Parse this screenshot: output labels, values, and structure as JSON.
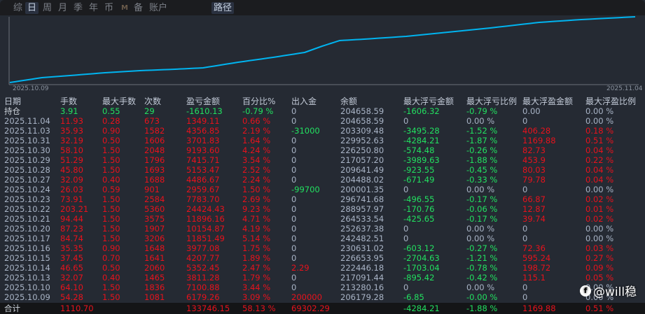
{
  "tabs": [
    "综",
    "日",
    "周",
    "月",
    "季",
    "年",
    "币",
    "M",
    "备",
    "账户",
    "路径"
  ],
  "active_tabs": [
    "日",
    "路径"
  ],
  "chart": {
    "x_start_label": "2025.10.09",
    "x_end_label": "2025.11.04",
    "line_color": "#00b4f0"
  },
  "columns": [
    "日期",
    "手数",
    "最大手数",
    "次数",
    "盈亏金额",
    "百分比%",
    "出入金",
    "余额",
    "最大浮亏金额",
    "最大浮亏比例",
    "最大浮盈金额",
    "最大浮盈比例"
  ],
  "holding": [
    "持仓",
    "3.91",
    "0.55",
    "29",
    "-1610.13",
    "-0.79 %",
    "0",
    "204658.59",
    "-1606.32",
    "-0.79 %",
    "0.00",
    "0.00 %"
  ],
  "rows": [
    [
      "2025.11.04",
      "11.93",
      "0.28",
      "673",
      "1349.11",
      "0.66 %",
      "0",
      "204658.59",
      "0",
      "0.00 %",
      "0",
      "0.00 %"
    ],
    [
      "2025.11.03",
      "35.93",
      "0.90",
      "1582",
      "4356.85",
      "2.19 %",
      "-31000",
      "203309.48",
      "-3495.28",
      "-1.52 %",
      "406.28",
      "0.18 %"
    ],
    [
      "2025.10.31",
      "32.19",
      "0.50",
      "1606",
      "3701.83",
      "1.64 %",
      "0",
      "229952.63",
      "-4284.21",
      "-1.87 %",
      "1169.88",
      "0.51 %"
    ],
    [
      "2025.10.30",
      "58.10",
      "1.50",
      "2048",
      "9193.60",
      "4.24 %",
      "0",
      "226250.80",
      "-574.48",
      "-0.26 %",
      "82.73",
      "0.04 %"
    ],
    [
      "2025.10.29",
      "51.29",
      "1.50",
      "1796",
      "7415.71",
      "3.54 %",
      "0",
      "217057.20",
      "-3989.63",
      "-1.88 %",
      "453.9",
      "0.22 %"
    ],
    [
      "2025.10.28",
      "45.80",
      "1.50",
      "1693",
      "5153.47",
      "2.52 %",
      "0",
      "209641.49",
      "-923.55",
      "-0.45 %",
      "80.03",
      "0.04 %"
    ],
    [
      "2025.10.27",
      "32.09",
      "0.40",
      "1688",
      "4486.67",
      "2.24 %",
      "0",
      "204488.02",
      "-671.49",
      "-0.33 %",
      "79.78",
      "0.04 %"
    ],
    [
      "2025.10.24",
      "26.03",
      "0.59",
      "901",
      "2959.67",
      "1.50 %",
      "-99700",
      "200001.35",
      "0",
      "0.00 %",
      "0",
      "0.00 %"
    ],
    [
      "2025.10.23",
      "73.91",
      "1.50",
      "2584",
      "7783.70",
      "2.69 %",
      "0",
      "296741.68",
      "-496.55",
      "-0.17 %",
      "66.87",
      "0.02 %"
    ],
    [
      "2025.10.22",
      "203.21",
      "1.50",
      "5360",
      "24424.43",
      "9.23 %",
      "0",
      "288957.97",
      "-170.76",
      "-0.06 %",
      "12.87",
      "0.01 %"
    ],
    [
      "2025.10.21",
      "94.44",
      "1.50",
      "3575",
      "11896.16",
      "4.71 %",
      "0",
      "264533.54",
      "-425.65",
      "-0.17 %",
      "39.74",
      "0.02 %"
    ],
    [
      "2025.10.20",
      "87.23",
      "1.50",
      "1907",
      "10154.87",
      "4.19 %",
      "0",
      "252637.38",
      "0",
      "0.00 %",
      "0",
      "0.00 %"
    ],
    [
      "2025.10.17",
      "84.74",
      "1.50",
      "3206",
      "11851.49",
      "5.14 %",
      "0",
      "242482.51",
      "0",
      "0.00 %",
      "0",
      "0.00 %"
    ],
    [
      "2025.10.16",
      "35.35",
      "0.90",
      "1648",
      "3977.08",
      "1.75 %",
      "0",
      "230631.02",
      "-603.12",
      "-0.27 %",
      "72.36",
      "0.03 %"
    ],
    [
      "2025.10.15",
      "37.45",
      "0.70",
      "1641",
      "4207.77",
      "1.89 %",
      "0",
      "226653.95",
      "-2704.63",
      "-1.21 %",
      "595.24",
      "0.27 %"
    ],
    [
      "2025.10.14",
      "46.65",
      "0.50",
      "2060",
      "5352.45",
      "2.47 %",
      "2.29",
      "222446.18",
      "-1703.04",
      "-0.78 %",
      "198.72",
      "0.09 %"
    ],
    [
      "2025.10.13",
      "32.07",
      "0.40",
      "1465",
      "3811.28",
      "1.79 %",
      "0",
      "217091.44",
      "-895.42",
      "-0.42 %",
      "115.1",
      "0.05 %"
    ],
    [
      "2025.10.10",
      "64.10",
      "1.50",
      "1836",
      "7100.88",
      "3.44 %",
      "0",
      "213280.16",
      "0",
      "0.00 %",
      "0",
      "0.00 %"
    ],
    [
      "2025.10.09",
      "54.28",
      "1.50",
      "1081",
      "6179.26",
      "3.09 %",
      "200000",
      "206179.28",
      "-6.85",
      "-0.00 %",
      "0",
      "0.00 %"
    ]
  ],
  "total": [
    "合计",
    "1110.70",
    "",
    "",
    "133746.15",
    "58.13 %",
    "69302.29",
    "",
    "-4284.21",
    "-1.88 %",
    "1169.88",
    "0.51 %"
  ],
  "watermark": "@will稳",
  "colors": {
    "positive": "#e8121c",
    "negative": "#22e060",
    "neutral": "#a9b4c6",
    "background": "#252a33"
  }
}
